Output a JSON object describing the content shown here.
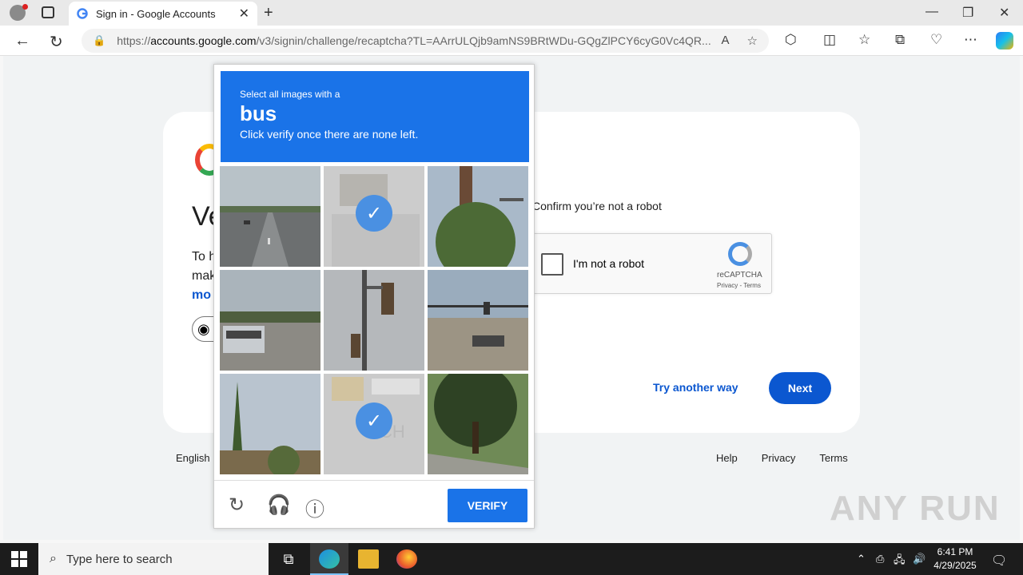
{
  "browser": {
    "tab_title": "Sign in - Google Accounts",
    "url_prefix": "https://",
    "url_domain": "accounts.google.com",
    "url_path": "/v3/signin/challenge/recaptcha?TL=AArrULQjb9amNS9BRtWDu-GQgZlPCY6cyG0Vc4QR..."
  },
  "page": {
    "title_partial": "Ve",
    "desc_line1": "To h",
    "desc_line2": "mak",
    "desc_more": "mo",
    "confirm_text": "Confirm you’re not a robot",
    "not_robot_label": "I'm not a robot",
    "recaptcha_brand": "reCAPTCHA",
    "recaptcha_links": "Privacy - Terms",
    "try_another": "Try another way",
    "next": "Next",
    "language": "English (",
    "footer": [
      "Help",
      "Privacy",
      "Terms"
    ]
  },
  "challenge": {
    "instruction": "Select all images with a",
    "target": "bus",
    "hint": "Click verify once there are none left.",
    "verify": "VERIFY",
    "tiles": [
      {
        "scene": "highway",
        "selected": false
      },
      {
        "scene": "bus-street",
        "selected": true
      },
      {
        "scene": "tower-tree",
        "selected": false
      },
      {
        "scene": "bus-highway",
        "selected": false
      },
      {
        "scene": "traffic-light",
        "selected": false
      },
      {
        "scene": "intersection",
        "selected": false
      },
      {
        "scene": "trees-sky",
        "selected": false
      },
      {
        "scene": "school-bus",
        "selected": true
      },
      {
        "scene": "tree-sidewalk",
        "selected": false
      }
    ]
  },
  "watermark": "ANY RUN",
  "taskbar": {
    "search_placeholder": "Type here to search",
    "time": "6:41 PM",
    "date": "4/29/2025"
  }
}
